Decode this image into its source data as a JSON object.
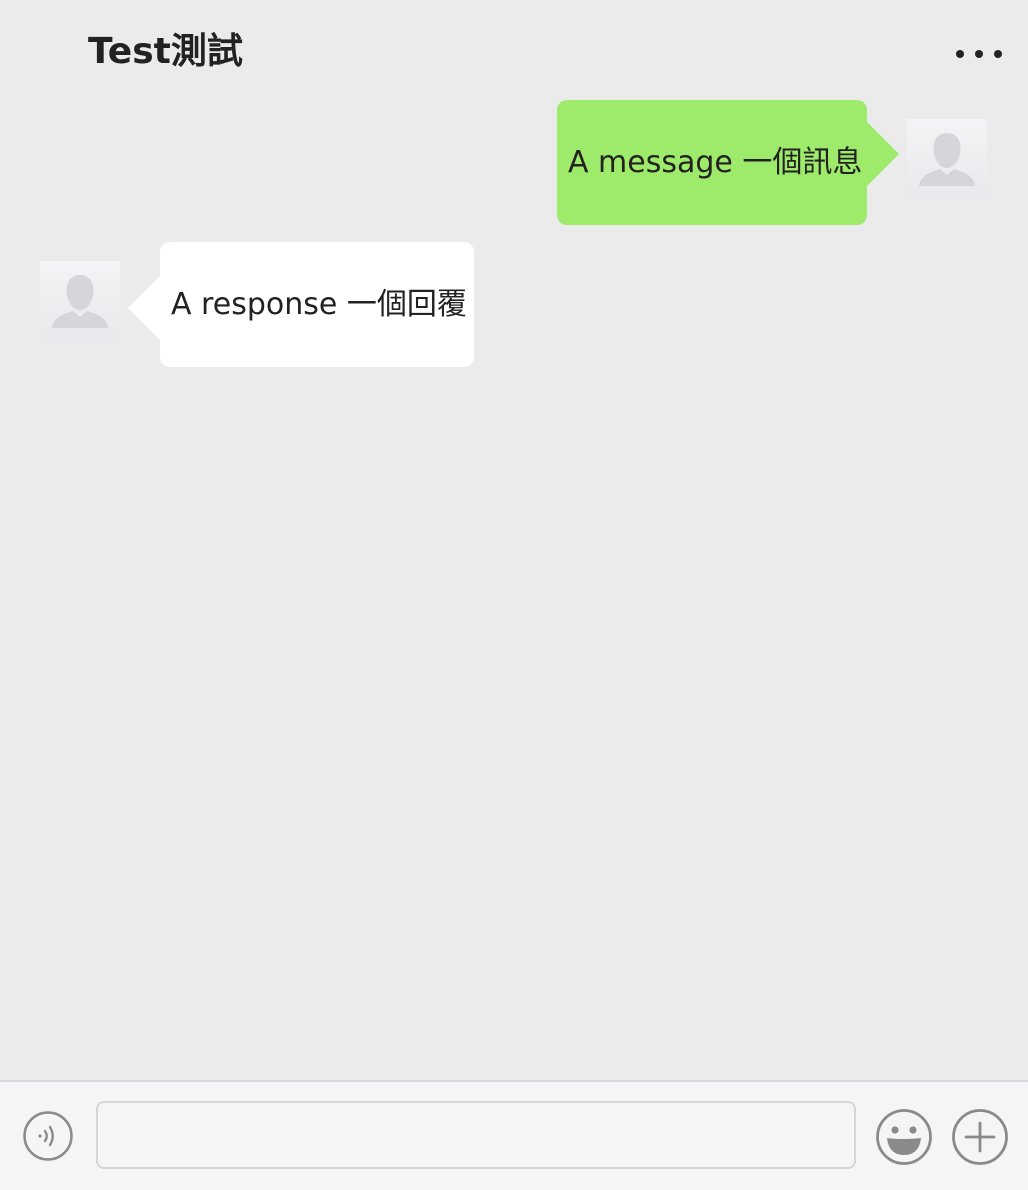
{
  "header": {
    "title": "Test測試",
    "more_icon": "more-dots-icon"
  },
  "messages": [
    {
      "direction": "sent",
      "text": "A message 一個訊息",
      "avatar_icon": "default-avatar-icon",
      "bubble_color": "#9eea6a"
    },
    {
      "direction": "received",
      "text": "A response 一個回覆",
      "avatar_icon": "default-avatar-icon",
      "bubble_color": "#ffffff"
    }
  ],
  "input_bar": {
    "voice_icon": "voice-icon",
    "input_value": "",
    "emoji_icon": "emoji-icon",
    "plus_icon": "plus-icon"
  },
  "colors": {
    "background": "#ebebeb",
    "sent_bubble": "#9eea6a",
    "received_bubble": "#ffffff",
    "input_bar_background": "#f5f5f7"
  }
}
